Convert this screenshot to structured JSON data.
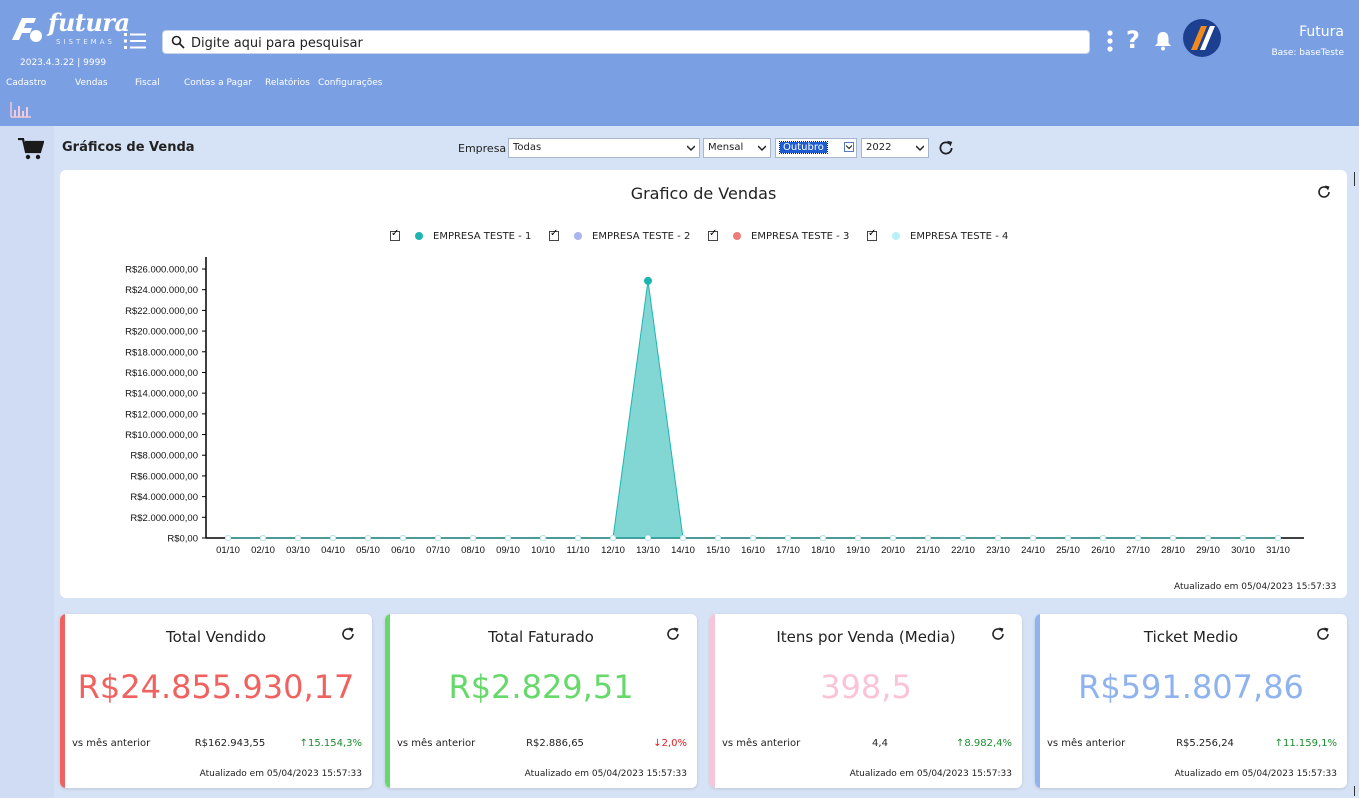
{
  "app": {
    "logo_text": "futura",
    "logo_sub": "SISTEMAS",
    "version": "2023.4.3.22 | 9999",
    "search_placeholder": "Digite aqui para pesquisar",
    "user_name": "Futura",
    "user_base": "Base: baseTeste"
  },
  "menu": [
    "Cadastro",
    "Vendas",
    "Fiscal",
    "Contas a Pagar",
    "Relatórios",
    "Configurações"
  ],
  "page": {
    "title": "Gráficos de Venda",
    "filters": {
      "empresa_label": "Empresa",
      "empresa": "Todas",
      "periodo": "Mensal",
      "mes": "Outubro",
      "ano": "2022"
    }
  },
  "chart_data": {
    "type": "area",
    "title": "Grafico de Vendas",
    "categories": [
      "01/10",
      "02/10",
      "03/10",
      "04/10",
      "05/10",
      "06/10",
      "07/10",
      "08/10",
      "09/10",
      "10/10",
      "11/10",
      "12/10",
      "13/10",
      "14/10",
      "15/10",
      "16/10",
      "17/10",
      "18/10",
      "19/10",
      "20/10",
      "21/10",
      "22/10",
      "23/10",
      "24/10",
      "25/10",
      "26/10",
      "27/10",
      "28/10",
      "29/10",
      "30/10",
      "31/10"
    ],
    "series": [
      {
        "name": "EMPRESA TESTE - 1",
        "color": "#1cb5b0",
        "values": [
          0,
          0,
          0,
          0,
          0,
          0,
          0,
          0,
          0,
          0,
          0,
          0,
          24855930.17,
          0,
          0,
          0,
          0,
          0,
          0,
          0,
          0,
          0,
          0,
          0,
          0,
          0,
          0,
          0,
          0,
          0,
          0
        ]
      },
      {
        "name": "EMPRESA TESTE - 2",
        "color": "#a7b5f0",
        "values": [
          0,
          0,
          0,
          0,
          0,
          0,
          0,
          0,
          0,
          0,
          0,
          0,
          0,
          0,
          0,
          0,
          0,
          0,
          0,
          0,
          0,
          0,
          0,
          0,
          0,
          0,
          0,
          0,
          0,
          0,
          0
        ]
      },
      {
        "name": "EMPRESA TESTE - 3",
        "color": "#ef7b7b",
        "values": [
          0,
          0,
          0,
          0,
          0,
          0,
          0,
          0,
          0,
          0,
          0,
          0,
          0,
          0,
          0,
          0,
          0,
          0,
          0,
          0,
          0,
          0,
          0,
          0,
          0,
          0,
          0,
          0,
          0,
          0,
          0
        ]
      },
      {
        "name": "EMPRESA TESTE - 4",
        "color": "#b9f0f5",
        "values": [
          0,
          0,
          0,
          0,
          0,
          0,
          0,
          0,
          0,
          0,
          0,
          0,
          0,
          0,
          0,
          0,
          0,
          0,
          0,
          0,
          0,
          0,
          0,
          0,
          0,
          0,
          0,
          0,
          0,
          0,
          0
        ]
      }
    ],
    "y_ticks": [
      "R$0,00",
      "R$2.000.000,00",
      "R$4.000.000,00",
      "R$6.000.000,00",
      "R$8.000.000,00",
      "R$10.000.000,00",
      "R$12.000.000,00",
      "R$14.000.000,00",
      "R$16.000.000,00",
      "R$18.000.000,00",
      "R$20.000.000,00",
      "R$22.000.000,00",
      "R$24.000.000,00",
      "R$26.000.000,00"
    ],
    "ylim": [
      0,
      26000000
    ],
    "grid": false,
    "legend_position": "top",
    "updated": "Atualizado em 05/04/2023 15:57:33"
  },
  "kpis": [
    {
      "title": "Total Vendido",
      "value": "R$24.855.930,17",
      "color": "#f0625f",
      "label": "vs mês anterior",
      "previous": "R$162.943,55",
      "delta": "↑15.154,3%",
      "delta_color": "#1a8c2e",
      "updated": "Atualizado em 05/04/2023 15:57:33"
    },
    {
      "title": "Total Faturado",
      "value": "R$2.829,51",
      "color": "#66d96a",
      "label": "vs mês anterior",
      "previous": "R$2.886,65",
      "delta": "↓2,0%",
      "delta_color": "#e02020",
      "updated": "Atualizado em 05/04/2023 15:57:33"
    },
    {
      "title": "Itens por Venda (Media)",
      "value": "398,5",
      "color": "#fbc4d6",
      "label": "vs mês anterior",
      "previous": "4,4",
      "delta": "↑8.982,4%",
      "delta_color": "#1a8c2e",
      "updated": "Atualizado em 05/04/2023 15:57:33"
    },
    {
      "title": "Ticket Medio",
      "value": "R$591.807,86",
      "color": "#8fb3ee",
      "label": "vs mês anterior",
      "previous": "R$5.256,24",
      "delta": "↑11.159,1%",
      "delta_color": "#1a8c2e",
      "updated": "Atualizado em 05/04/2023 15:57:33"
    }
  ]
}
